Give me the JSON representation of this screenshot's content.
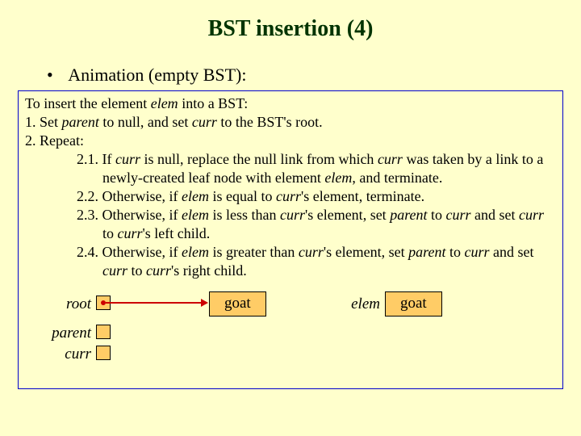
{
  "title": "BST insertion (4)",
  "bullet": "Animation (empty BST):",
  "algo": {
    "l0": "To insert the element ",
    "l0b": " into a BST:",
    "l1a": "1.  Set ",
    "l1b": " to null, and set ",
    "l1c": " to the BST's root.",
    "l2": "2.  Repeat:",
    "l21a": "2.1. If ",
    "l21b": " is null, replace the null link from which ",
    "l21c": " was taken by a link to a newly-created leaf node with element ",
    "l21d": ", and terminate.",
    "l22a": "2.2. Otherwise, if ",
    "l22b": " is equal to ",
    "l22c": "'s element, terminate.",
    "l23a": "2.3. Otherwise, if ",
    "l23b": " is less than ",
    "l23c": "'s element, set ",
    "l23d": " to ",
    "l23e": " and set ",
    "l23f": " to ",
    "l23g": "'s left child.",
    "l24a": "2.4. Otherwise, if ",
    "l24b": " is greater than ",
    "l24c": "'s element, set ",
    "l24d": " to ",
    "l24e": " and set ",
    "l24f": " to ",
    "l24g": "'s right child."
  },
  "vars": {
    "elem": "elem",
    "parent": "parent",
    "curr": "curr",
    "root": "root"
  },
  "diagram": {
    "root_label": "root",
    "parent_label": "parent",
    "curr_label": "curr",
    "elem_label": "elem",
    "node_value": "goat",
    "elem_value": "goat"
  }
}
